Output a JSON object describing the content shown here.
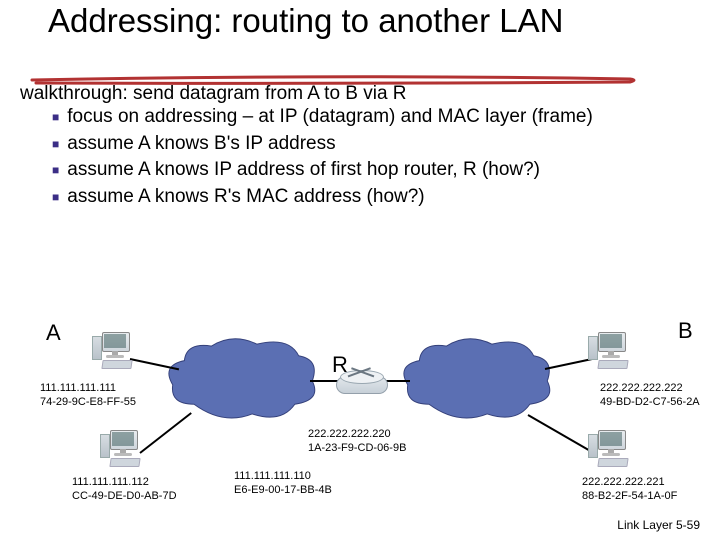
{
  "title": "Addressing: routing to another LAN",
  "intro": "walkthrough: send datagram from A to B via R",
  "bullets": [
    "focus on addressing – at IP (datagram) and MAC layer (frame)",
    "assume A knows B's IP address",
    "assume A knows IP address of first hop router, R (how?)",
    "assume A knows R's MAC address (how?)"
  ],
  "labels": {
    "A": "A",
    "B": "B",
    "R": "R"
  },
  "nodes": {
    "a": {
      "ip": "111.111.111.111",
      "mac": "74-29-9C-E8-FF-55"
    },
    "a2": {
      "ip": "111.111.111.112",
      "mac": "CC-49-DE-D0-AB-7D"
    },
    "r_left": {
      "ip": "111.111.111.110",
      "mac": "E6-E9-00-17-BB-4B"
    },
    "r_right": {
      "ip": "222.222.222.220",
      "mac": "1A-23-F9-CD-06-9B"
    },
    "b": {
      "ip": "222.222.222.222",
      "mac": "49-BD-D2-C7-56-2A"
    },
    "b2": {
      "ip": "222.222.222.221",
      "mac": "88-B2-2F-54-1A-0F"
    }
  },
  "footer": "Link Layer  5-59",
  "colors": {
    "bullet_square": "#3b2e86",
    "cloud_fill": "#5b6fb3",
    "underline": "#b23232"
  }
}
